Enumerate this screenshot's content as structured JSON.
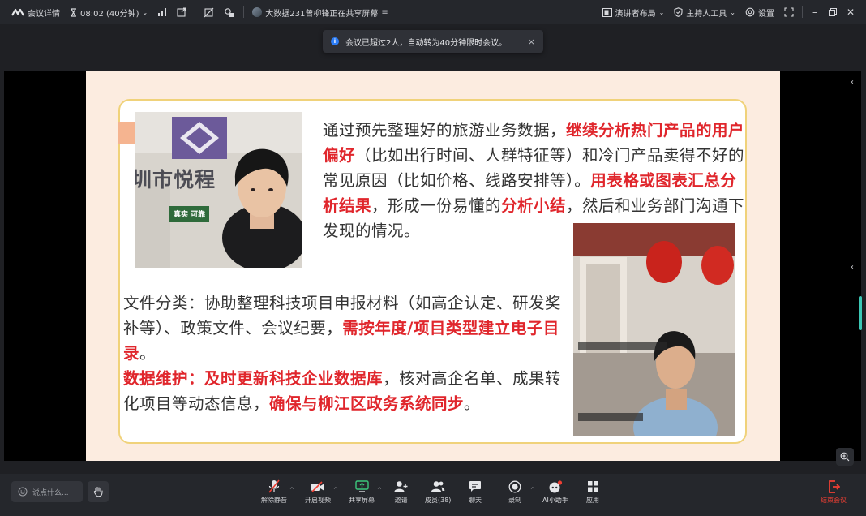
{
  "topbar": {
    "meeting_details": "会议详情",
    "timer": "08:02 (40分钟)",
    "sharing_status": "大数据231曾柳锋正在共享屏幕",
    "layout_label": "演讲者布局",
    "host_tools_label": "主持人工具",
    "settings_label": "设置",
    "icons": [
      "tencent-meeting-logo",
      "hourglass-icon",
      "signal-bars-icon",
      "popout-icon",
      "whiteboard-off-icon",
      "share-mode-icon",
      "avatar-icon",
      "menu-lines-icon",
      "layout-icon",
      "shield-icon",
      "gear-icon",
      "fullscreen-icon"
    ]
  },
  "notice": {
    "text": "会议已超过2人，自动转为40分钟限时会议。",
    "close": "×"
  },
  "slide": {
    "para1": [
      {
        "t": "通过预先整理好的旅游业务数据，",
        "hl": false
      },
      {
        "t": "继续分析热门产品的用户偏好",
        "hl": true
      },
      {
        "t": "（比如出行时间、人群特征等）和冷门产品卖得不好的常见原因（比如价格、线路安排等）。",
        "hl": false
      },
      {
        "t": "用表格或图表汇总分析结果",
        "hl": true
      },
      {
        "t": "，形成一份易懂的",
        "hl": false
      },
      {
        "t": "分析小结",
        "hl": true
      },
      {
        "t": "，然后和业务部门沟通下发现的情况。",
        "hl": false
      }
    ],
    "para2": [
      {
        "t": "文件分类：协助整理科技项目申报材料（如高企认定、研发奖补等）、政策文件、会议纪要，",
        "hl": false
      },
      {
        "t": "需按年度/项目类型建立电子目录",
        "hl": true
      },
      {
        "t": "。",
        "hl": false
      },
      {
        "t": "数据维护：及时更新科技企业数据库",
        "hl": true
      },
      {
        "t": "，核对高企名单、成果转化项目等动态信息，",
        "hl": false
      },
      {
        "t": "确保与柳江区政务系统同步",
        "hl": true
      },
      {
        "t": "。",
        "hl": false
      }
    ],
    "cam1_sign_text": "圳市悦程",
    "cam1_slogan": "真实 可靠",
    "colors": {
      "highlight": "#e0262c",
      "card_border": "#f0d27a",
      "slide_bg": "#fcece0"
    }
  },
  "bottombar": {
    "chat_placeholder": "说点什么...",
    "controls": [
      {
        "label": "解除静音",
        "icon": "mic-muted-icon"
      },
      {
        "label": "开启视频",
        "icon": "camera-off-icon"
      },
      {
        "label": "共享屏幕",
        "icon": "share-screen-icon"
      },
      {
        "label": "邀请",
        "icon": "invite-icon"
      },
      {
        "label": "成员(38)",
        "icon": "members-icon"
      },
      {
        "label": "聊天",
        "icon": "chat-icon"
      },
      {
        "label": "录制",
        "icon": "record-icon"
      },
      {
        "label": "AI小助手",
        "icon": "ai-assistant-icon"
      },
      {
        "label": "应用",
        "icon": "apps-icon"
      }
    ],
    "end_label": "结束会议"
  }
}
